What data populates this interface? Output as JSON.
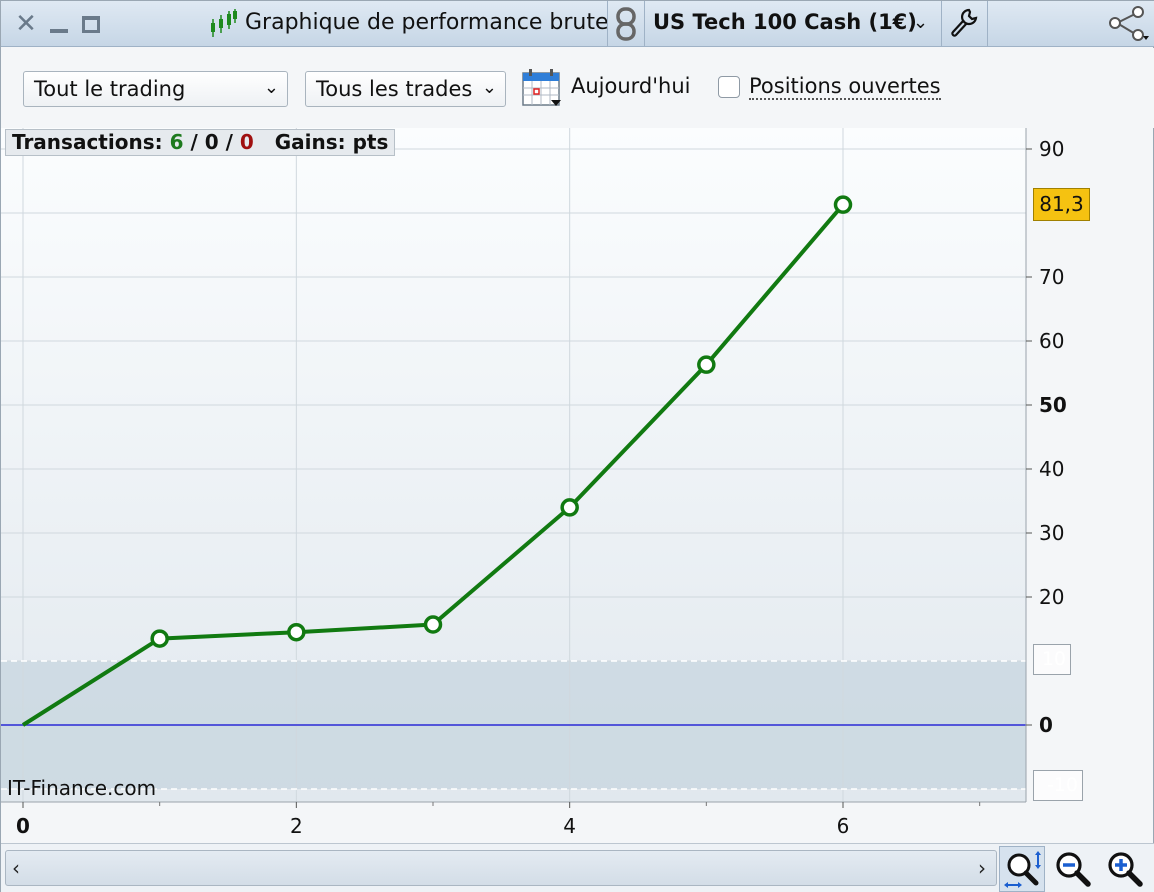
{
  "window": {
    "title": "Graphique de performance brute",
    "instrument": "US Tech 100 Cash (1€)"
  },
  "toolbar": {
    "scope_select": "Tout le trading",
    "trades_select": "Tous les trades",
    "today_label": "Aujourd'hui",
    "open_positions_label": "Positions ouvertes",
    "open_positions_checked": false
  },
  "stats": {
    "label": "Transactions:",
    "wins": "6",
    "neutral": "0",
    "losses": "0",
    "sep": "/",
    "gains_label": "Gains: pts"
  },
  "watermark": "IT-Finance.com",
  "badges": {
    "last_value": "81,3",
    "upper_band": "10",
    "lower_band": "-10"
  },
  "colors": {
    "series": "#117a11",
    "zero_line": "#2a2ad6",
    "badge": "#f5c211",
    "wins": "#1e7a1e",
    "losses": "#a01010"
  },
  "chart_data": {
    "type": "line",
    "x": [
      0,
      1,
      2,
      3,
      4,
      5,
      6
    ],
    "series": [
      {
        "values": [
          0,
          13.5,
          14.5,
          15.7,
          34,
          56.3,
          81.3
        ]
      }
    ],
    "xlim": [
      0,
      7.3
    ],
    "ylim": [
      -10,
      90
    ],
    "x_ticks": [
      "0",
      "2",
      "4",
      "6"
    ],
    "x_tick_values": [
      0,
      2,
      4,
      6
    ],
    "y_ticks": [
      "0",
      "20",
      "30",
      "40",
      "50",
      "60",
      "70",
      "90"
    ],
    "y_tick_values": [
      0,
      20,
      30,
      40,
      50,
      60,
      70,
      90
    ],
    "band": [
      -10,
      10
    ],
    "zero_line": 0,
    "grid": true
  }
}
